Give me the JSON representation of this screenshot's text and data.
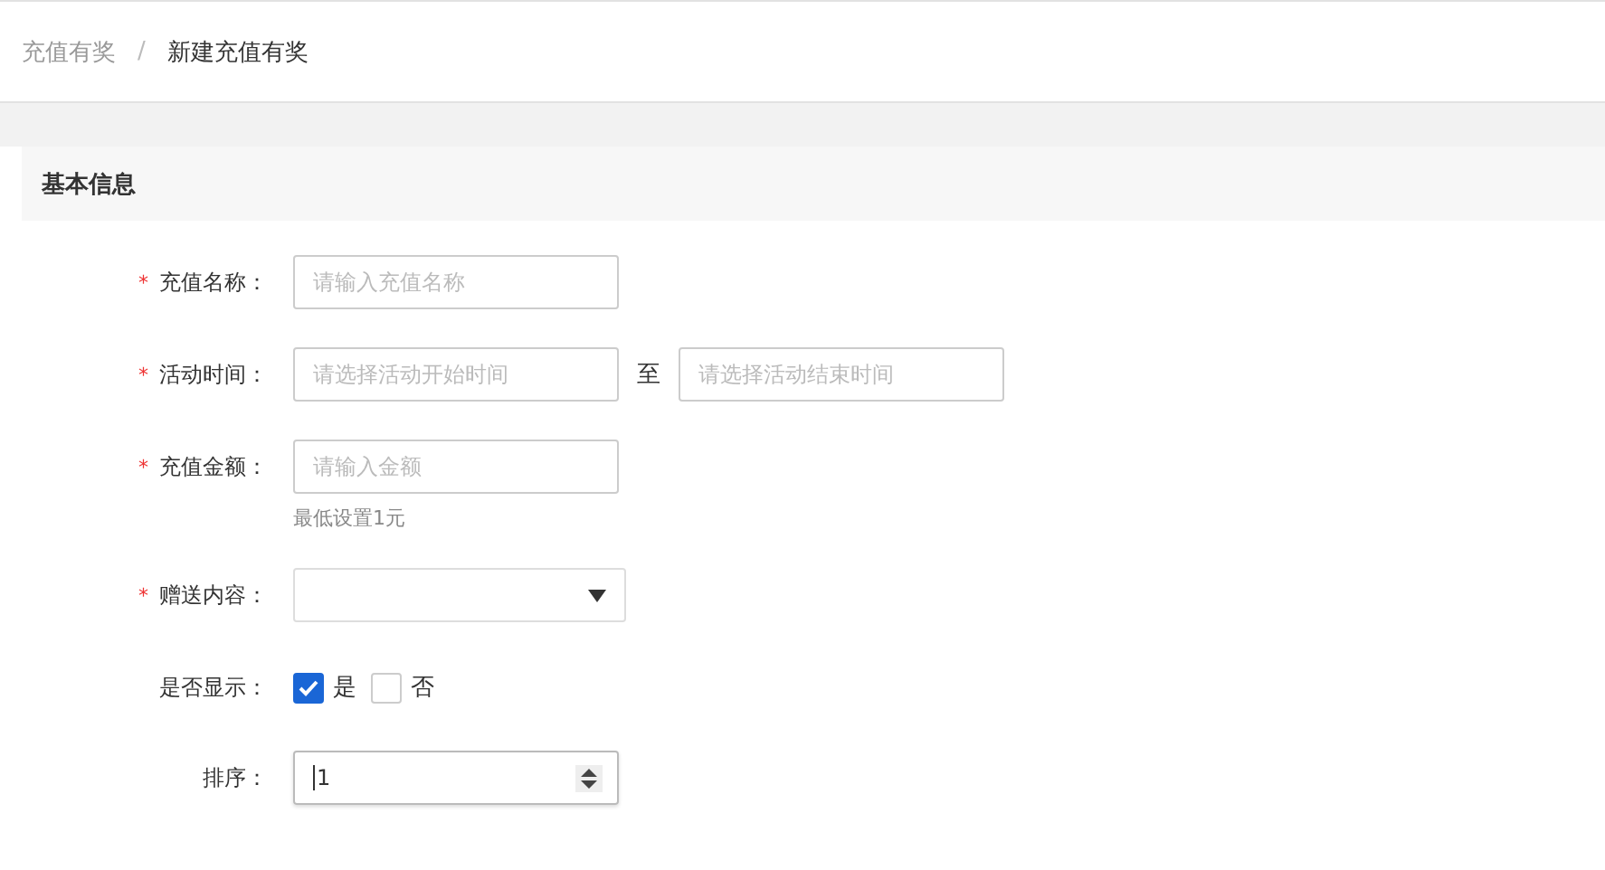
{
  "breadcrumb": [
    {
      "label": "充值有奖",
      "current": false
    },
    {
      "label": "新建充值有奖",
      "current": true
    }
  ],
  "breadcrumb_separator": "/",
  "section": {
    "title": "基本信息"
  },
  "fields": [
    {
      "kind": "text",
      "label": "充值名称：",
      "required_mark": "*",
      "placeholder": "请输入充值名称"
    },
    {
      "kind": "range",
      "label": "活动时间：",
      "required_mark": "*",
      "placeholder": "请选择活动开始时间",
      "separator": "至",
      "end_placeholder": "请选择活动结束时间"
    },
    {
      "kind": "text",
      "label": "充值金额：",
      "required_mark": "*",
      "placeholder": "请输入金额",
      "hint": "最低设置1元"
    },
    {
      "kind": "select",
      "label": "赠送内容：",
      "required_mark": "*"
    },
    {
      "kind": "checkboxes",
      "label": "是否显示：",
      "options": [
        {
          "label": "是",
          "checked": true
        },
        {
          "label": "否",
          "checked": false
        }
      ]
    },
    {
      "kind": "number",
      "label": "排序：",
      "value": "1"
    }
  ]
}
